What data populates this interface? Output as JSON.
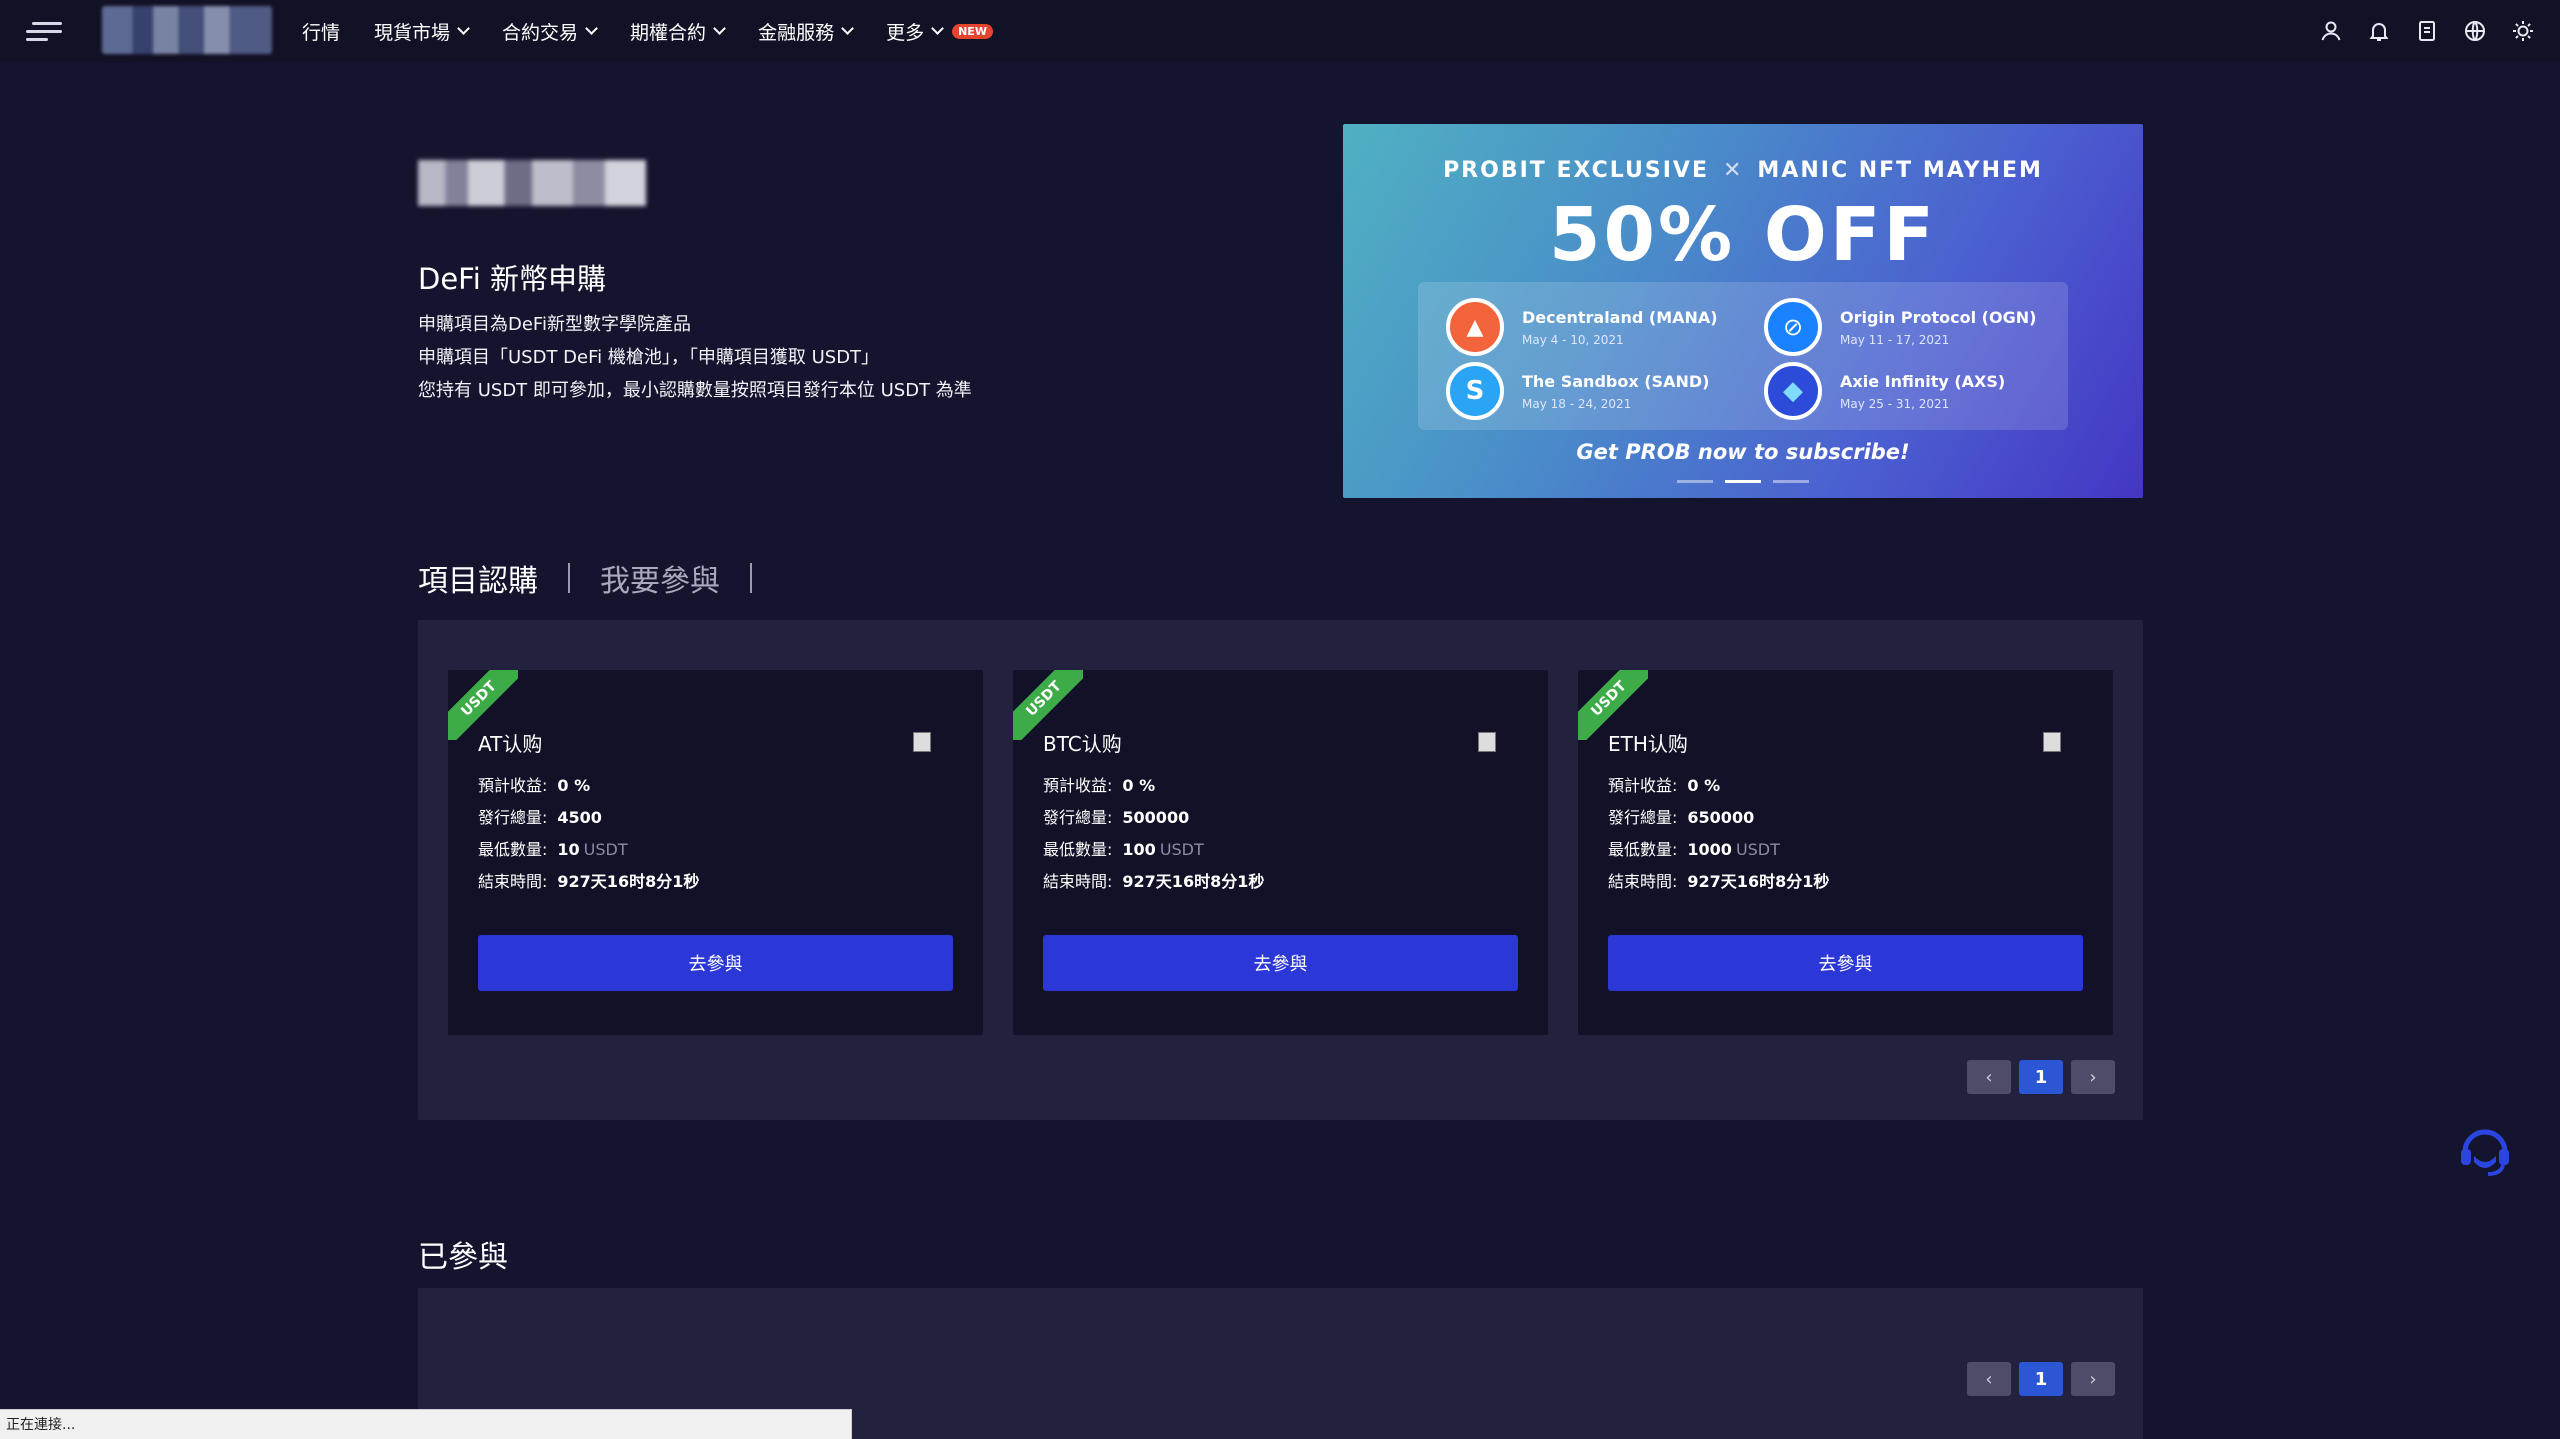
{
  "nav": {
    "items": [
      {
        "label": "行情",
        "dropdown": false
      },
      {
        "label": "現貨市場",
        "dropdown": true
      },
      {
        "label": "合約交易",
        "dropdown": true
      },
      {
        "label": "期權合約",
        "dropdown": true
      },
      {
        "label": "金融服務",
        "dropdown": true
      },
      {
        "label": "更多",
        "dropdown": true
      }
    ],
    "new_badge": "NEW",
    "icons": [
      "user-icon",
      "bell-icon",
      "document-icon",
      "globe-icon",
      "sun-icon"
    ]
  },
  "hero": {
    "title": "DeFi 新幣申購",
    "lines": [
      "申購項目為DeFi新型數字學院產品",
      "申購項目「USDT DeFi 機槍池」，「申購項目獲取 USDT」",
      "您持有 USDT 即可參加，最小認購數量按照項目發行本位 USDT 為準"
    ]
  },
  "banner": {
    "left": "PROBIT EXCLUSIVE",
    "sep": "✕",
    "right": "MANIC NFT MAYHEM",
    "headline": "50% OFF",
    "coins": [
      {
        "name": "Decentraland (MANA)",
        "date": "May 4 - 10, 2021",
        "color": "#f4643c",
        "glyph": "▲"
      },
      {
        "name": "Origin Protocol (OGN)",
        "date": "May 11 - 17, 2021",
        "color": "#1a82ff",
        "glyph": "⊘"
      },
      {
        "name": "The Sandbox (SAND)",
        "date": "May 18 - 24, 2021",
        "color": "#2aa4f4",
        "glyph": "S"
      },
      {
        "name": "Axie Infinity (AXS)",
        "date": "May 25 - 31, 2021",
        "color": "#2b4bd8",
        "glyph": "◆"
      }
    ],
    "cta": "Get PROB now to subscribe!",
    "slide_count": 3,
    "active_slide": 2
  },
  "tabs": {
    "active": "項目認購",
    "inactive": "我要參與"
  },
  "labels": {
    "expected_return": "預計收益:",
    "total_issue": "發行總量:",
    "min_amount": "最低數量:",
    "end_time": "結束時間:",
    "join_button": "去參與",
    "ribbon": "USDT",
    "unit": "USDT"
  },
  "cards": [
    {
      "title": "AT认购",
      "return": "0 %",
      "total": "4500",
      "min": "10",
      "end": "927天16时8分1秒"
    },
    {
      "title": "BTC认购",
      "return": "0 %",
      "total": "500000",
      "min": "100",
      "end": "927天16时8分1秒"
    },
    {
      "title": "ETH认购",
      "return": "0 %",
      "total": "650000",
      "min": "1000",
      "end": "927天16时8分1秒"
    }
  ],
  "pager": {
    "prev": "‹",
    "current": "1",
    "next": "›"
  },
  "joined": {
    "title": "已參與"
  },
  "status": "正在連接..."
}
